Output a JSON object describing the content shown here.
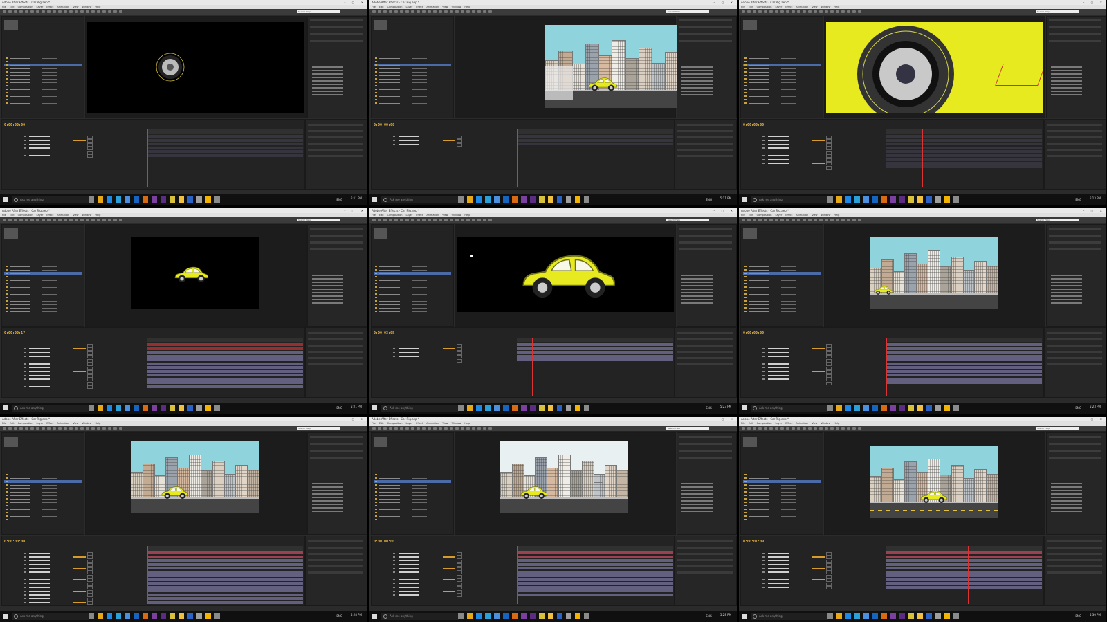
{
  "window": {
    "title": "Adobe After Effects - Car Rig.aep *",
    "controls": "– ▢ ✕"
  },
  "menu": [
    "File",
    "Edit",
    "Composition",
    "Layer",
    "Effect",
    "Animation",
    "View",
    "Window",
    "Help"
  ],
  "search_placeholder": "Search Help",
  "taskbar": {
    "search_placeholder": "Ask me anything",
    "language": "ENG"
  },
  "shots": [
    {
      "viewer": "wheel-dark",
      "timecode": "0:00:00:00",
      "clock": "5:11 PM"
    },
    {
      "viewer": "city-car",
      "timecode": "0:00:00:00",
      "clock": "5:11 PM"
    },
    {
      "viewer": "wheel-zoom",
      "timecode": "0:00:00:00",
      "clock": "5:13 PM"
    },
    {
      "viewer": "small-car-dark",
      "timecode": "0:00:00:17",
      "clock": "5:21 PM"
    },
    {
      "viewer": "big-car-dark",
      "timecode": "0:00:03:05",
      "clock": "5:23 PM"
    },
    {
      "viewer": "city-small",
      "timecode": "0:00:00:00",
      "clock": "5:23 PM"
    },
    {
      "viewer": "city-camera",
      "timecode": "0:00:00:00",
      "clock": "5:28 PM"
    },
    {
      "viewer": "city-3d",
      "timecode": "0:00:00:00",
      "clock": "5:28 PM"
    },
    {
      "viewer": "city-final",
      "timecode": "0:00:01:09",
      "clock": "5:30 PM"
    }
  ],
  "colors": {
    "car_body": "#e6ea1f",
    "sky": "#8fd3dd",
    "timecode": "#e2b23a",
    "playhead": "#dd3333",
    "layer_bar": "#6e6a8e"
  }
}
